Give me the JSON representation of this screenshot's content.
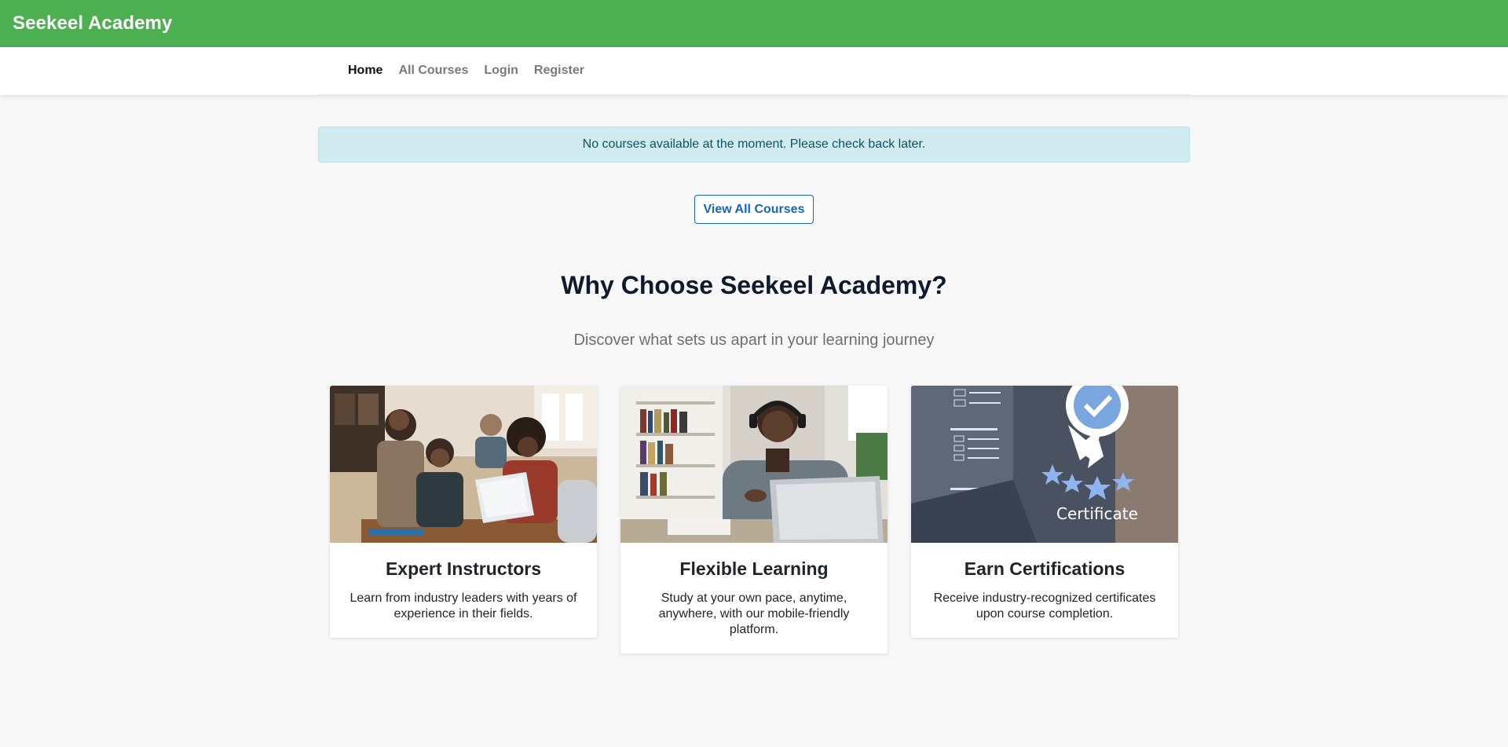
{
  "header": {
    "brand": "Seekeel Academy"
  },
  "nav": {
    "items": [
      {
        "label": "Home",
        "active": true
      },
      {
        "label": "All Courses",
        "active": false
      },
      {
        "label": "Login",
        "active": false
      },
      {
        "label": "Register",
        "active": false
      }
    ]
  },
  "alert": {
    "message": "No courses available at the moment. Please check back later."
  },
  "actions": {
    "view_all_label": "View All Courses"
  },
  "features": {
    "title": "Why Choose Seekeel Academy?",
    "subtitle": "Discover what sets us apart in your learning journey",
    "cards": [
      {
        "title": "Expert Instructors",
        "text": "Learn from industry leaders with years of experience in their fields.",
        "image": "classroom-group-photo"
      },
      {
        "title": "Flexible Learning",
        "text": "Study at your own pace, anytime, anywhere, with our mobile-friendly platform.",
        "image": "student-with-laptop-photo"
      },
      {
        "title": "Earn Certifications",
        "text": "Receive industry-recognized certificates upon course completion.",
        "image": "certificate-badge-photo",
        "image_caption": "Certificate"
      }
    ]
  },
  "colors": {
    "header_bg": "#4caf50",
    "alert_bg": "#d1ecf1",
    "alert_text": "#0c5460",
    "button_accent": "#1565c0"
  }
}
